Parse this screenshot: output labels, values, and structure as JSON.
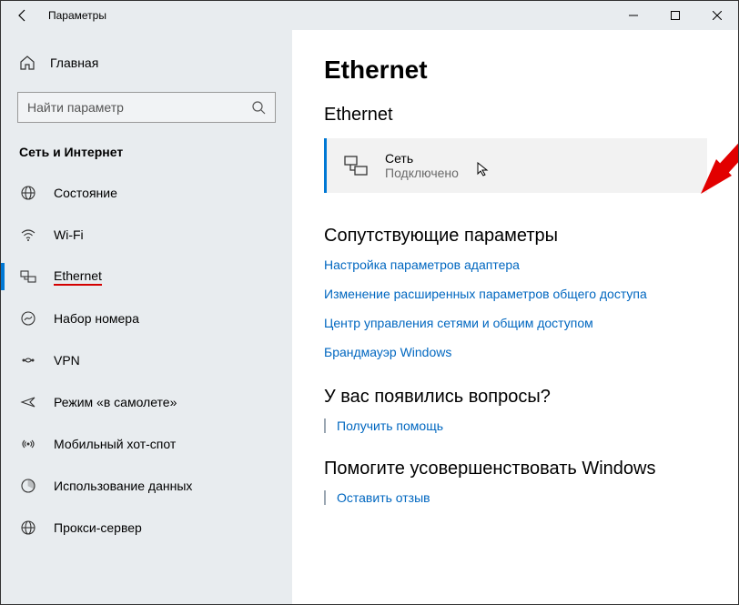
{
  "window": {
    "title": "Параметры"
  },
  "sidebar": {
    "home": "Главная",
    "search_placeholder": "Найти параметр",
    "section": "Сеть и Интернет",
    "items": [
      {
        "label": "Состояние"
      },
      {
        "label": "Wi-Fi"
      },
      {
        "label": "Ethernet"
      },
      {
        "label": "Набор номера"
      },
      {
        "label": "VPN"
      },
      {
        "label": "Режим «в самолете»"
      },
      {
        "label": "Мобильный хот-спот"
      },
      {
        "label": "Использование данных"
      },
      {
        "label": "Прокси-сервер"
      }
    ]
  },
  "content": {
    "heading": "Ethernet",
    "subheading": "Ethernet",
    "network": {
      "name": "Сеть",
      "status": "Подключено"
    },
    "related_title": "Сопутствующие параметры",
    "related_links": [
      "Настройка параметров адаптера",
      "Изменение расширенных параметров общего доступа",
      "Центр управления сетями и общим доступом",
      "Брандмауэр Windows"
    ],
    "questions_title": "У вас появились вопросы?",
    "questions_link": "Получить помощь",
    "improve_title": "Помогите усовершенствовать Windows",
    "improve_link": "Оставить отзыв"
  }
}
